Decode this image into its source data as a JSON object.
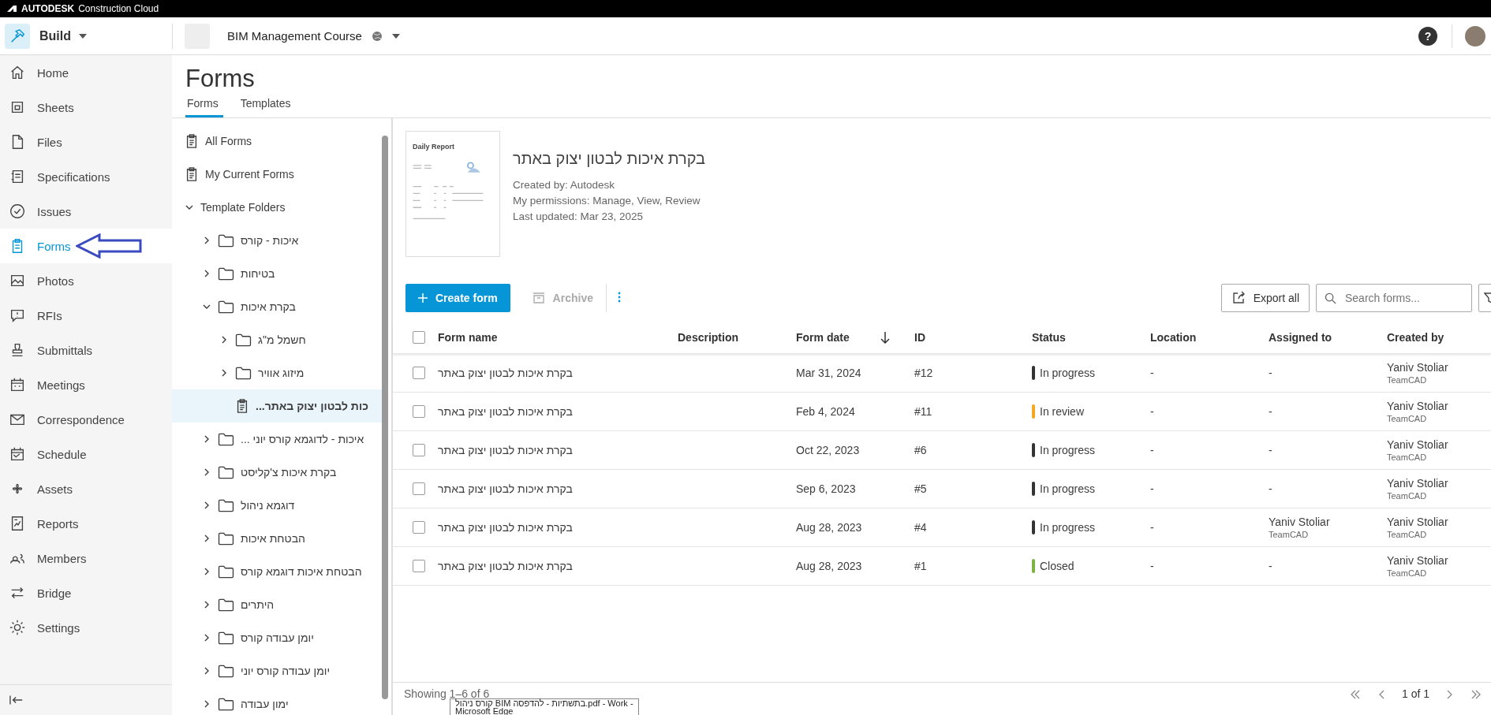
{
  "brand": {
    "name": "AUTODESK",
    "product": "Construction Cloud"
  },
  "header": {
    "app": "Build",
    "project": "BIM Management Course",
    "help": "?"
  },
  "nav": [
    {
      "label": "Home",
      "selected": false
    },
    {
      "label": "Sheets",
      "selected": false
    },
    {
      "label": "Files",
      "selected": false
    },
    {
      "label": "Specifications",
      "selected": false
    },
    {
      "label": "Issues",
      "selected": false
    },
    {
      "label": "Forms",
      "selected": true
    },
    {
      "label": "Photos",
      "selected": false
    },
    {
      "label": "RFIs",
      "selected": false
    },
    {
      "label": "Submittals",
      "selected": false
    },
    {
      "label": "Meetings",
      "selected": false
    },
    {
      "label": "Correspondence",
      "selected": false
    },
    {
      "label": "Schedule",
      "selected": false
    },
    {
      "label": "Assets",
      "selected": false
    },
    {
      "label": "Reports",
      "selected": false
    },
    {
      "label": "Members",
      "selected": false
    },
    {
      "label": "Bridge",
      "selected": false
    },
    {
      "label": "Settings",
      "selected": false
    }
  ],
  "page_title": "Forms",
  "tabs": [
    {
      "label": "Forms",
      "selected": true
    },
    {
      "label": "Templates",
      "selected": false
    }
  ],
  "tree": [
    {
      "kind": "list",
      "label": "All Forms",
      "selected": false
    },
    {
      "kind": "list",
      "label": "My Current Forms",
      "selected": false
    },
    {
      "kind": "group",
      "label": "Template Folders",
      "expanded": true,
      "selected": false,
      "children": [
        {
          "kind": "folder",
          "label": "איכות - קורס",
          "expanded": false,
          "selected": false
        },
        {
          "kind": "folder",
          "label": "בטיחות",
          "expanded": false,
          "selected": false
        },
        {
          "kind": "folder",
          "label": "בקרת איכות",
          "expanded": true,
          "selected": false,
          "children": [
            {
              "kind": "folder",
              "label": "חשמל מ\"ג",
              "expanded": false,
              "selected": false
            },
            {
              "kind": "folder",
              "label": "מיזוג אוויר",
              "expanded": false,
              "selected": false
            },
            {
              "kind": "form",
              "label": "...כות לבטון יצוק באתר",
              "selected": true
            }
          ]
        },
        {
          "kind": "folder",
          "label": "... איכות - לדוגמא קורס יוני",
          "expanded": false,
          "selected": false
        },
        {
          "kind": "folder",
          "label": "בקרת איכות צ'קליסט",
          "expanded": false,
          "selected": false
        },
        {
          "kind": "folder",
          "label": "דוגמא ניהול",
          "expanded": false,
          "selected": false
        },
        {
          "kind": "folder",
          "label": "הבטחת איכות",
          "expanded": false,
          "selected": false
        },
        {
          "kind": "folder",
          "label": "הבטחת איכות דוגמא קורס",
          "expanded": false,
          "selected": false
        },
        {
          "kind": "folder",
          "label": "היתרים",
          "expanded": false,
          "selected": false
        },
        {
          "kind": "folder",
          "label": "יומן עבודה קורס",
          "expanded": false,
          "selected": false
        },
        {
          "kind": "folder",
          "label": "יומן עבודה קורס יוני",
          "expanded": false,
          "selected": false
        },
        {
          "kind": "folder",
          "label": "ימון עבודה",
          "expanded": false,
          "selected": false
        }
      ]
    }
  ],
  "template": {
    "thumbnail_title": "Daily Report",
    "title": "בקרת איכות לבטון יצוק באתר",
    "details": [
      "Created by: Autodesk",
      "My permissions: Manage, View, Review",
      "Last updated: Mar 23, 2025"
    ]
  },
  "toolbar": {
    "create": "Create form",
    "archive": {
      "label": "Archive",
      "disabled": true
    },
    "export": "Export all",
    "search": {
      "placeholder": "Search forms..."
    }
  },
  "table": {
    "all_selected": false,
    "columns": [
      {
        "label": "Form name"
      },
      {
        "label": "Description"
      },
      {
        "label": "Form date",
        "sorted": true
      },
      {
        "label": "ID"
      },
      {
        "label": "Status"
      },
      {
        "label": "Location"
      },
      {
        "label": "Assigned to"
      },
      {
        "label": "Created by"
      }
    ],
    "rows": [
      {
        "checked": false,
        "name": "בקרת איכות לבטון יצוק באתר",
        "date": "Mar 31, 2024",
        "id": "#12",
        "status": "In progress",
        "color": "#333333",
        "location": "-",
        "assigned": {
          "name": "-"
        },
        "created": {
          "name": "Yaniv Stoliar",
          "company": "TeamCAD"
        }
      },
      {
        "checked": false,
        "name": "בקרת איכות לבטון יצוק באתר",
        "date": "Feb 4, 2024",
        "id": "#11",
        "status": "In review",
        "color": "#f5a623",
        "location": "-",
        "assigned": {
          "name": "-"
        },
        "created": {
          "name": "Yaniv Stoliar",
          "company": "TeamCAD"
        }
      },
      {
        "checked": false,
        "name": "בקרת איכות לבטון יצוק באתר",
        "date": "Oct 22, 2023",
        "id": "#6",
        "status": "In progress",
        "color": "#333333",
        "location": "-",
        "assigned": {
          "name": "-"
        },
        "created": {
          "name": "Yaniv Stoliar",
          "company": "TeamCAD"
        }
      },
      {
        "checked": false,
        "name": "בקרת איכות לבטון יצוק באתר",
        "date": "Sep 6, 2023",
        "id": "#5",
        "status": "In progress",
        "color": "#333333",
        "location": "-",
        "assigned": {
          "name": "-"
        },
        "created": {
          "name": "Yaniv Stoliar",
          "company": "TeamCAD"
        }
      },
      {
        "checked": false,
        "name": "בקרת איכות לבטון יצוק באתר",
        "date": "Aug 28, 2023",
        "id": "#4",
        "status": "In progress",
        "color": "#333333",
        "location": "-",
        "assigned": {
          "name": "Yaniv Stoliar",
          "company": "TeamCAD"
        },
        "created": {
          "name": "Yaniv Stoliar",
          "company": "TeamCAD"
        }
      },
      {
        "checked": false,
        "name": "בקרת איכות לבטון יצוק באתר",
        "date": "Aug 28, 2023",
        "id": "#1",
        "status": "Closed",
        "color": "#7cb342",
        "location": "-",
        "assigned": {
          "name": "-"
        },
        "created": {
          "name": "Yaniv Stoliar",
          "company": "TeamCAD"
        }
      }
    ]
  },
  "footer": {
    "showing": "Showing 1–6 of 6",
    "page": "1 of 1"
  },
  "tooltip": [
    "קורס ניהול BIM בתשתיות - להדפסה.pdf - Work -",
    "Microsoft Edge"
  ]
}
